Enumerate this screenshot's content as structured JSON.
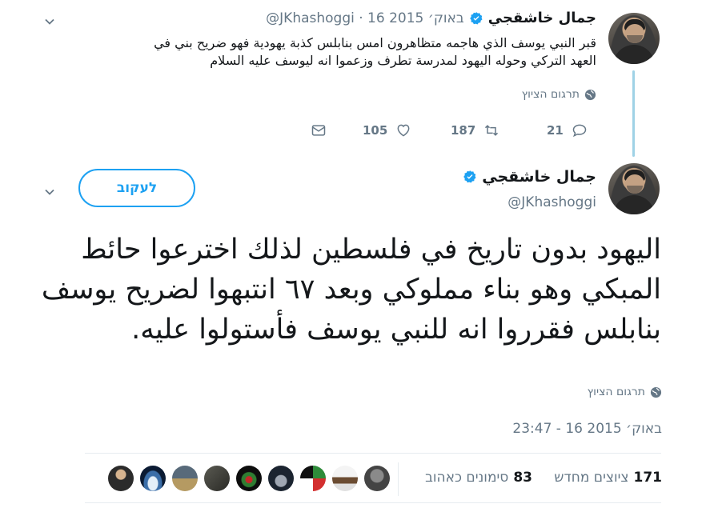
{
  "reply_tweet": {
    "author_name": "جمال خاشقجي",
    "handle_and_date": "@JKhashoggi · 16 באוק׳ 2015",
    "text_line1": "قبر النبي يوسف الذي هاجمه متظاهرون امس بنابلس كذبة يهودية فهو ضريح بني في",
    "text_line2": "العهد التركي وحوله اليهود لمدرسة تطرف وزعموا انه ليوسف عليه السلام",
    "translate_label": "תרגום הציוץ",
    "actions": {
      "replies": "21",
      "retweets": "187",
      "likes": "105"
    }
  },
  "main_tweet": {
    "author_name": "جمال خاشقجي",
    "handle": "@JKhashoggi",
    "follow_label": "לעקוב",
    "text": "اليهود بدون تاريخ في فلسطين لذلك اخترعوا حائط المبكي وهو بناء مملوكي وبعد ٦٧ انتبهوا لضريح يوسف بنابلس فقرروا انه للنبي يوسف فأستولوا عليه.",
    "translate_label": "תרגום הציוץ",
    "timestamp": "23:47 - 16 באוק׳ 2015",
    "stats": {
      "retweets_count": "171",
      "retweets_label": "ציוצים מחדש",
      "likes_count": "83",
      "likes_label": "סימונים כאהוב"
    }
  },
  "colors": {
    "accent": "#1da1f2",
    "muted": "#657786",
    "thread_line": "#9fd2e6",
    "divider": "#e6ecf0"
  },
  "icons": [
    "verified-badge-icon",
    "globe-icon",
    "reply-icon",
    "retweet-icon",
    "like-icon",
    "dm-icon",
    "chevron-down-icon"
  ]
}
